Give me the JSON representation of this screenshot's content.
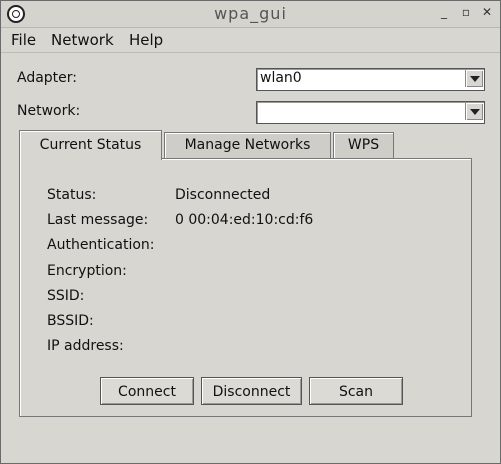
{
  "window": {
    "title": "wpa_gui"
  },
  "menu": [
    {
      "label": "File"
    },
    {
      "label": "Network"
    },
    {
      "label": "Help"
    }
  ],
  "form": {
    "adapter_label": "Adapter:",
    "adapter_value": "wlan0",
    "network_label": "Network:",
    "network_value": ""
  },
  "tabs": [
    {
      "label": "Current Status",
      "active": true
    },
    {
      "label": "Manage Networks",
      "active": false
    },
    {
      "label": "WPS",
      "active": false
    }
  ],
  "status": {
    "rows": [
      {
        "label": "Status:",
        "value": "Disconnected"
      },
      {
        "label": "Last message:",
        "value": "0 00:04:ed:10:cd:f6"
      },
      {
        "label": "Authentication:",
        "value": ""
      },
      {
        "label": "Encryption:",
        "value": ""
      },
      {
        "label": "SSID:",
        "value": ""
      },
      {
        "label": "BSSID:",
        "value": ""
      },
      {
        "label": "IP address:",
        "value": ""
      }
    ]
  },
  "buttons": {
    "connect": "Connect",
    "disconnect": "Disconnect",
    "scan": "Scan"
  },
  "icons": {
    "app": "app-logo-icon",
    "minimize": "minimize-icon",
    "maximize": "maximize-icon",
    "close": "close-icon",
    "dropdown": "chevron-down-icon"
  }
}
